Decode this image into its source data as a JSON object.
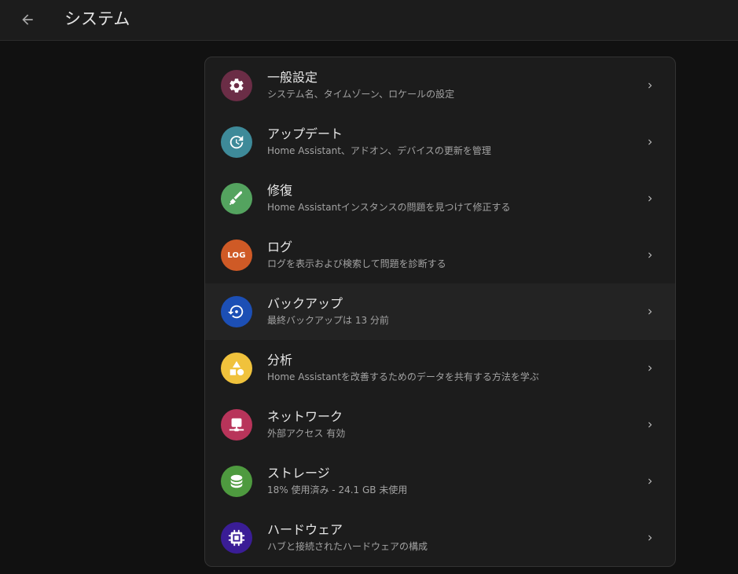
{
  "header": {
    "title": "システム",
    "back_icon": "arrow-left-icon"
  },
  "items": [
    {
      "title": "一般設定",
      "subtitle": "システム名、タイムゾーン、ロケールの設定",
      "icon": "gear-icon",
      "color": "#6b2d46"
    },
    {
      "title": "アップデート",
      "subtitle": "Home Assistant、アドオン、デバイスの更新を管理",
      "icon": "update-icon",
      "color": "#3e8a99"
    },
    {
      "title": "修復",
      "subtitle": "Home Assistantインスタンスの問題を見つけて修正する",
      "icon": "screwdriver-icon",
      "color": "#54a35f"
    },
    {
      "title": "ログ",
      "subtitle": "ログを表示および検索して問題を診断する",
      "icon": "log-icon",
      "icon_text": "LOG",
      "color": "#cf5a26"
    },
    {
      "title": "バックアップ",
      "subtitle": "最終バックアップは 13 分前",
      "icon": "backup-restore-icon",
      "color": "#1c4fb5"
    },
    {
      "title": "分析",
      "subtitle": "Home Assistantを改善するためのデータを共有する方法を学ぶ",
      "icon": "shapes-icon",
      "color": "#f0c23c"
    },
    {
      "title": "ネットワーク",
      "subtitle": "外部アクセス 有効",
      "icon": "network-icon",
      "color": "#b8345a"
    },
    {
      "title": "ストレージ",
      "subtitle": "18% 使用済み - 24.1 GB 未使用",
      "icon": "database-icon",
      "color": "#4e9a3f"
    },
    {
      "title": "ハードウェア",
      "subtitle": "ハブと接続されたハードウェアの構成",
      "icon": "chip-icon",
      "color": "#3a1d96"
    }
  ],
  "chevron_icon": "chevron-right-icon"
}
